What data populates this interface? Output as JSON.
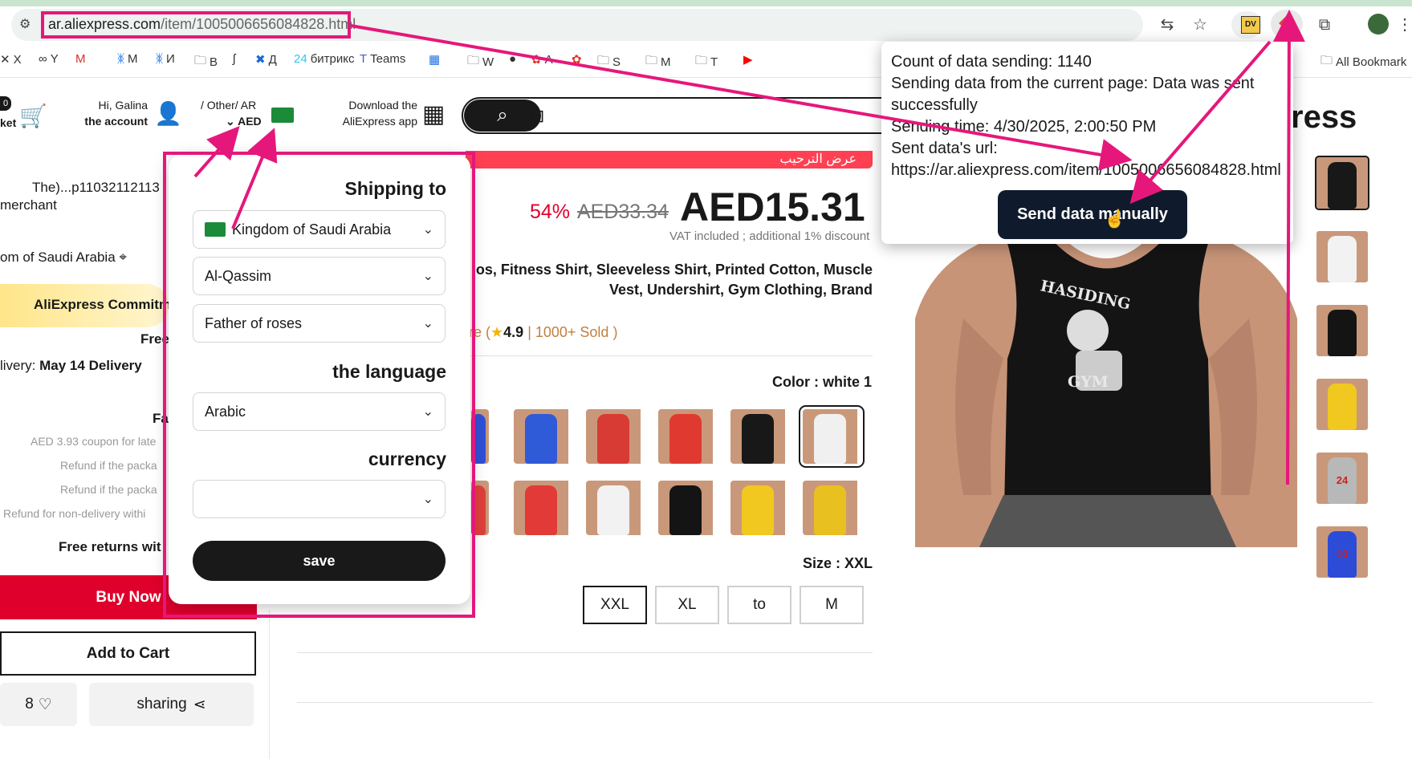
{
  "browser": {
    "url_host": "ar.aliexpress.com",
    "url_path": "/item/1005006656084828.html",
    "bookmarks": [
      {
        "label": "X",
        "icon": "x-icon"
      },
      {
        "label": "Y",
        "icon": "link-icon"
      },
      {
        "label": "",
        "icon": "gmail-icon"
      },
      {
        "label": "M",
        "icon": "butterfly-icon"
      },
      {
        "label": "И",
        "icon": "butterfly-icon"
      },
      {
        "label": "B",
        "icon": "folder-icon"
      },
      {
        "label": "",
        "icon": "symfony-icon"
      },
      {
        "label": "Д",
        "icon": "confluence-icon"
      },
      {
        "label": "битрикс",
        "icon": "bitrix24-icon"
      },
      {
        "label": "Teams",
        "icon": "teams-icon"
      },
      {
        "label": "",
        "icon": "calendar-icon"
      },
      {
        "label": "W",
        "icon": "folder-icon"
      },
      {
        "label": "",
        "icon": "github-icon"
      },
      {
        "label": "A",
        "icon": "aliexpress-icon"
      },
      {
        "label": "",
        "icon": "aliexpress-icon"
      },
      {
        "label": "S",
        "icon": "folder-icon"
      },
      {
        "label": "M",
        "icon": "folder-icon"
      },
      {
        "label": "T",
        "icon": "folder-icon"
      },
      {
        "label": "",
        "icon": "youtube-icon"
      }
    ],
    "all_bookmarks": "All Bookmark"
  },
  "header": {
    "cart_label": "ket",
    "cart_count": "0",
    "greeting": "Hi, Galina",
    "account": "the account",
    "region_line": "/ Other/ AR",
    "currency": "AED",
    "app_line1": "Download the",
    "app_line2": "AliExpress app",
    "brand_partial": "ress"
  },
  "left": {
    "seller_line": "The)...p11032112113",
    "merchant": "merchant",
    "ship_to": "om of Saudi Arabia",
    "commitment": "AliExpress Commitm",
    "free": "Free",
    "delivery_prefix": "livery:",
    "delivery_date": "May 14",
    "delivery_word": "Delivery",
    "fa": "Fa",
    "coupon": "AED 3.93 coupon for late",
    "refund1": "Refund if the packa",
    "refund2": "Refund if the packa",
    "refund3": "Refund for non-delivery withi",
    "free_returns": "Free returns wit",
    "buy_now": "Buy Now",
    "add_to_cart": "Add to Cart",
    "wish_count": "8",
    "sharing": "sharing"
  },
  "settings": {
    "shipping_to": "Shipping to",
    "country": "Kingdom of Saudi Arabia",
    "region": "Al-Qassim",
    "city": "Father of roses",
    "language_label": "the language",
    "language": "Arabic",
    "currency_label": "currency",
    "currency": "",
    "save": "save"
  },
  "product": {
    "promo_text": "عرض الترحيب",
    "discount": "54%",
    "old_price": "AED33.34",
    "price": "AED15.31",
    "vat": "VAT included ; additional 1% discount",
    "title_line1": "os, Fitness Shirt, Sleeveless Shirt, Printed Cotton, Muscle",
    "title_line2": "Vest, Undershirt, Gym Clothing, Brand",
    "rating_prefix": "re (",
    "rating": "4.9",
    "sold": "| 1000+ Sold )",
    "color_label": "Color : white 1",
    "size_label": "Size : XXL",
    "sizes": [
      "XXL",
      "XL",
      "to",
      "M"
    ],
    "print_text_top": "HASIDING",
    "print_text_bottom": "GYM",
    "colors": {
      "row1": [
        "#3050d8",
        "#2f5ad8",
        "#d83a34",
        "#e03a30",
        "#181818",
        "#f0f0f0"
      ],
      "row2": [
        "#e0403a",
        "#e23a36",
        "#f2f2f2",
        "#141414",
        "#f0c820",
        "#e8c020"
      ],
      "thumbs": [
        "#181818",
        "#f2f2f2",
        "#141414",
        "#f0c820",
        "#b8b8b8",
        "#2c4cd8"
      ]
    },
    "thumb_numbers": [
      "",
      "",
      "",
      "",
      "24",
      "10"
    ]
  },
  "extension": {
    "count": "Count of data sending: 1140",
    "status_line1": "Sending data from the current page: Data was sent",
    "status_line2": "successfully",
    "time": "Sending time: 4/30/2025, 2:00:50 PM",
    "url_label": "Sent data's url:",
    "url": "https://ar.aliexpress.com/item/1005006656084828.html",
    "button": "Send data manually"
  },
  "annotation_color": "#e5177b"
}
